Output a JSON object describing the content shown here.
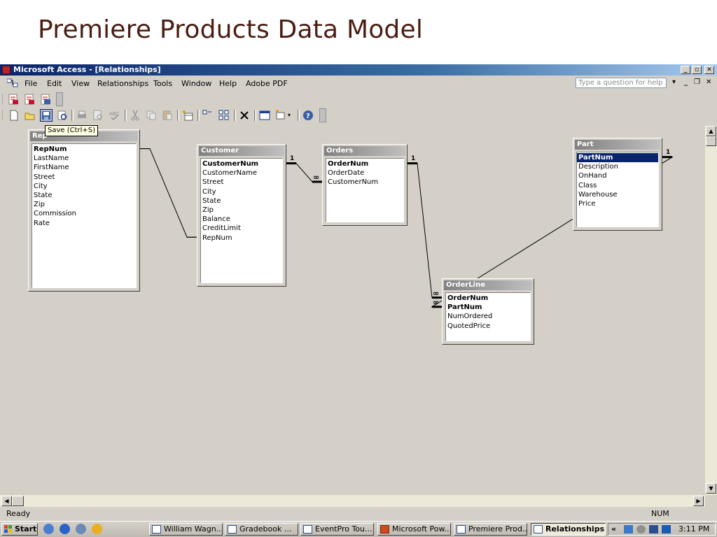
{
  "slide": {
    "title": "Premiere Products Data Model"
  },
  "window": {
    "title": "Microsoft Access - [Relationships]",
    "controls": {
      "minimize": "_",
      "restore": "▫",
      "close": "✕"
    }
  },
  "menu": {
    "items": [
      "File",
      "Edit",
      "View",
      "Relationships",
      "Tools",
      "Window",
      "Help",
      "Adobe PDF"
    ],
    "help_placeholder": "Type a question for help",
    "help_dropdown": "▾",
    "mdi_controls": {
      "minimize": "_",
      "restore": "❐",
      "close": "✕"
    }
  },
  "tooltip": "Save (Ctrl+S)",
  "tables": [
    {
      "name": "Rep",
      "fields": [
        "RepNum",
        "LastName",
        "FirstName",
        "Street",
        "City",
        "State",
        "Zip",
        "Commission",
        "Rate"
      ],
      "primary": [
        "RepNum"
      ]
    },
    {
      "name": "Customer",
      "fields": [
        "CustomerNum",
        "CustomerName",
        "Street",
        "City",
        "State",
        "Zip",
        "Balance",
        "CreditLimit",
        "RepNum"
      ],
      "primary": [
        "CustomerNum"
      ]
    },
    {
      "name": "Orders",
      "fields": [
        "OrderNum",
        "OrderDate",
        "CustomerNum"
      ],
      "primary": [
        "OrderNum"
      ]
    },
    {
      "name": "Part",
      "fields": [
        "PartNum",
        "Description",
        "OnHand",
        "Class",
        "Warehouse",
        "Price"
      ],
      "primary": [
        "PartNum"
      ],
      "selected": "PartNum"
    },
    {
      "name": "OrderLine",
      "fields": [
        "OrderNum",
        "PartNum",
        "NumOrdered",
        "QuotedPrice"
      ],
      "primary": [
        "OrderNum",
        "PartNum"
      ]
    }
  ],
  "relationships": [
    {
      "from": "Rep.RepNum",
      "to": "Customer.RepNum",
      "one": "",
      "many": ""
    },
    {
      "from": "Customer.CustomerNum",
      "to": "Orders.CustomerNum",
      "one": "1",
      "many": "∞"
    },
    {
      "from": "Orders.OrderNum",
      "to": "OrderLine.OrderNum",
      "one": "1",
      "many": "∞"
    },
    {
      "from": "Part.PartNum",
      "to": "OrderLine.PartNum",
      "one": "1",
      "many": "∞"
    }
  ],
  "status": {
    "text": "Ready",
    "num": "NUM"
  },
  "taskbar": {
    "start": "Start",
    "tasks": [
      {
        "label": "William Wagn...",
        "active": false
      },
      {
        "label": "Gradebook  ...",
        "active": false
      },
      {
        "label": "EventPro Tou...",
        "active": false
      },
      {
        "label": "Microsoft Pow...",
        "active": false
      },
      {
        "label": "Premiere Prod...",
        "active": false
      },
      {
        "label": "Relationships",
        "active": true
      }
    ],
    "tray_chevron": "«",
    "clock": "3:11 PM"
  }
}
